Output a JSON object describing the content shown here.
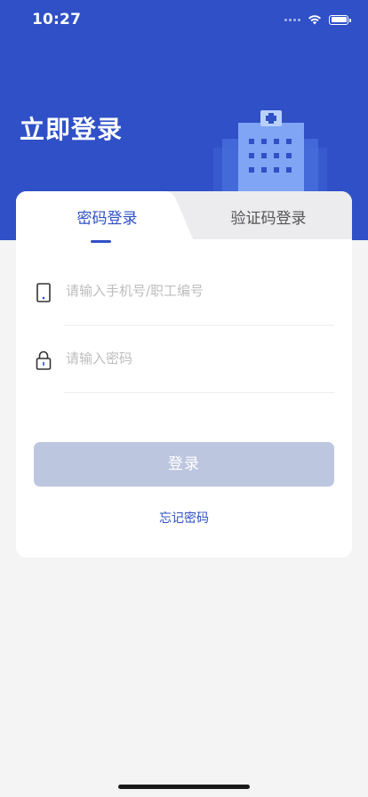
{
  "status_bar": {
    "time": "10:27",
    "icons": [
      "cellular-signal-icon",
      "wifi-icon",
      "battery-icon"
    ]
  },
  "header": {
    "title": "立即登录",
    "illustration": "hospital-building-icon",
    "background_color": "#2f50c6"
  },
  "tabs": [
    {
      "label": "密码登录",
      "active": true
    },
    {
      "label": "验证码登录",
      "active": false
    }
  ],
  "form": {
    "phone": {
      "placeholder": "请输入手机号/职工编号",
      "value": "",
      "icon": "phone-icon"
    },
    "password": {
      "placeholder": "请输入密码",
      "value": "",
      "icon": "lock-icon"
    },
    "submit_label": "登录",
    "forgot_label": "忘记密码"
  },
  "colors": {
    "accent": "#2f50c6",
    "button_disabled": "#bdc6df",
    "page_background": "#f4f4f4"
  }
}
